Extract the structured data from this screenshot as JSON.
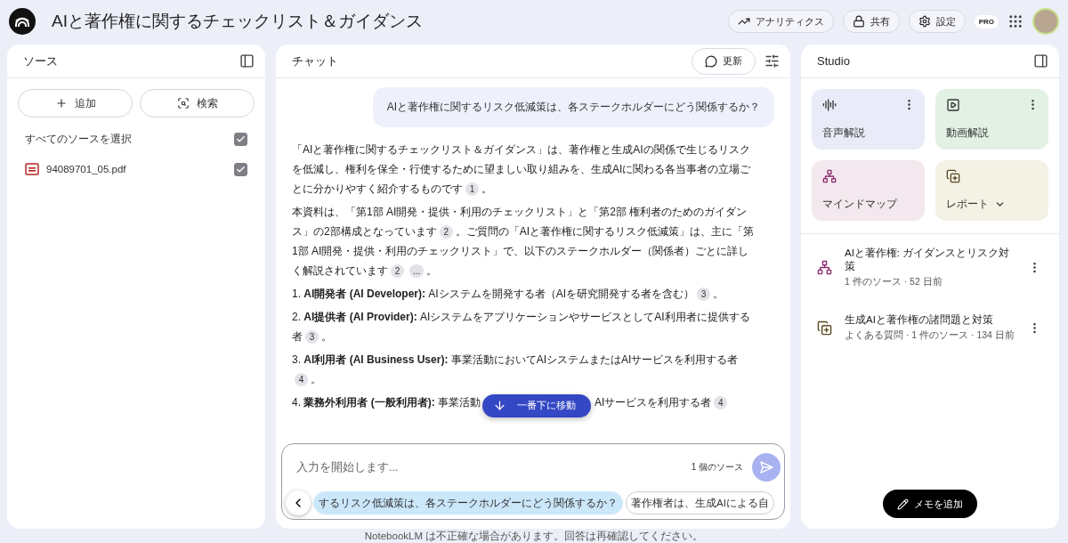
{
  "header": {
    "title": "AIと著作権に関するチェックリスト＆ガイダンス",
    "actions": [
      {
        "kind": "analytics",
        "label": "アナリティクス"
      },
      {
        "kind": "share",
        "label": "共有"
      },
      {
        "kind": "settings",
        "label": "設定"
      }
    ],
    "badge": "PRO"
  },
  "sources": {
    "title": "ソース",
    "buttons": [
      {
        "kind": "add",
        "label": "追加"
      },
      {
        "kind": "search",
        "label": "検索"
      }
    ],
    "select_all": {
      "label": "すべてのソースを選択",
      "checked": true
    },
    "items": [
      {
        "name": "94089701_05.pdf",
        "checked": true
      }
    ]
  },
  "chat": {
    "title": "チャット",
    "refresh": "更新",
    "question": "AIと著作権に関するリスク低減策は、各ステークホルダーにどう関係するか？",
    "paragraphs": [
      [
        {
          "kind": "text",
          "text": "「AIと著作権に関するチェックリスト＆ガイダンス」は、著作権と生成AIの関係で生じるリスクを低減し、権利を保全・行使するために望ましい取り組みを、生成AIに関わる各当事者の立場ごとに分かりやすく紹介するものです"
        },
        {
          "kind": "cite",
          "text": "1"
        },
        {
          "kind": "text",
          "text": "。"
        }
      ],
      [
        {
          "kind": "text",
          "text": "本資料は、「第1部 AI開発・提供・利用のチェックリスト」と「第2部 権利者のためのガイダンス」の2部構成となっています"
        },
        {
          "kind": "cite",
          "text": "2"
        },
        {
          "kind": "text",
          "text": "。ご質問の「AIと著作権に関するリスク低減策」は、主に「第1部 AI開発・提供・利用のチェックリスト」で、以下のステークホルダー（関係者）ごとに詳しく解説されています"
        },
        {
          "kind": "cite",
          "text": "2"
        },
        {
          "kind": "cite",
          "text": "..."
        },
        {
          "kind": "text",
          "text": "。"
        }
      ],
      [
        {
          "kind": "text",
          "text": "1. **AI開発者 (AI Developer):** AIシステムを開発する者（AIを研究開発する者を含む）"
        },
        {
          "kind": "cite",
          "text": "3"
        },
        {
          "kind": "text",
          "text": "。"
        }
      ],
      [
        {
          "kind": "text",
          "text": "2. **AI提供者 (AI Provider):** AIシステムをアプリケーションやサービスとしてAI利用者に提供する者"
        },
        {
          "kind": "cite",
          "text": "3"
        },
        {
          "kind": "text",
          "text": "。"
        }
      ],
      [
        {
          "kind": "text",
          "text": "3. **AI利用者 (AI Business User):** 事業活動においてAIシステムまたはAIサービスを利用する者"
        },
        {
          "kind": "cite",
          "text": "4"
        },
        {
          "kind": "text",
          "text": "。"
        }
      ],
      [
        {
          "kind": "text",
          "text": "4. **業務外利用者 (一般利用者):** 事業活動"
        },
        {
          "kind": "jump"
        },
        {
          "kind": "text",
          "text": "AIサービスを利用する者"
        },
        {
          "kind": "cite",
          "text": "4"
        }
      ]
    ],
    "jump_button": "一番下に移動",
    "input": {
      "placeholder": "入力を開始します...",
      "source_count": "1 個のソース"
    },
    "suggestions": [
      {
        "text": "するリスク低減策は、各ステークホルダーにどう関係するか？",
        "selected": true
      },
      {
        "text": "著作権者は、生成AIによる自",
        "selected": false
      }
    ],
    "disclaimer": "NotebookLM は不正確な場合があります。回答は再確認してください。"
  },
  "studio": {
    "title": "Studio",
    "tiles": [
      {
        "kind": "audio",
        "label": "音声解説",
        "color": "#e9ebf8",
        "menu": true,
        "dropdown": false
      },
      {
        "kind": "video",
        "label": "動画解説",
        "color": "#e2f1e4",
        "menu": true,
        "dropdown": false
      },
      {
        "kind": "mindmap",
        "label": "マインドマップ",
        "color": "#f3e8ee",
        "menu": false,
        "dropdown": false
      },
      {
        "kind": "report",
        "label": "レポート",
        "color": "#f3f2e5",
        "menu": false,
        "dropdown": true
      }
    ],
    "notes": [
      {
        "kind": "mindmap",
        "title": "AIと著作権: ガイダンスとリスク対策",
        "meta": "1 件のソース · 52 日前"
      },
      {
        "kind": "report",
        "title": "生成AIと著作権の諸問題と対策",
        "meta": "よくある質問 · 1 件のソース · 134 日前"
      }
    ],
    "add_note": "メモを追加"
  }
}
